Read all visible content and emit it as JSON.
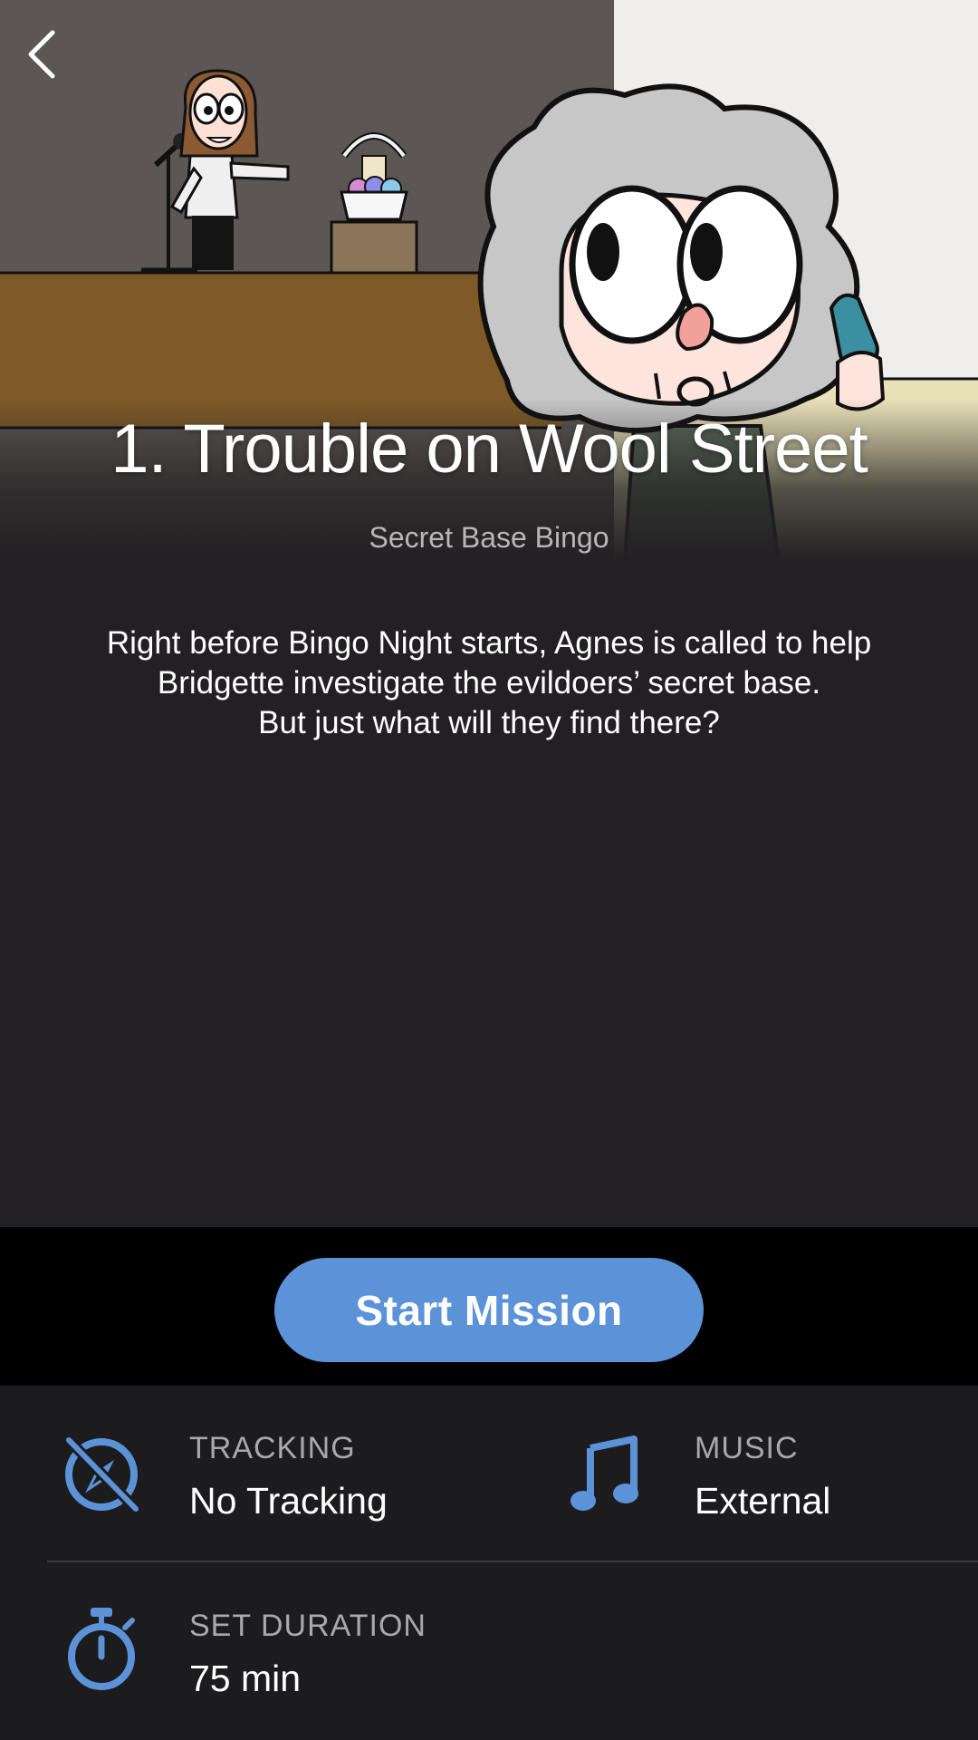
{
  "header": {
    "back_icon": "chevron-left-icon",
    "hero_image": "cartoon-illustration-grandma-on-phone-stage-with-microphone-and-yarn-basket"
  },
  "mission": {
    "title": "1. Trouble on Wool Street",
    "subtitle": "Secret Base Bingo",
    "description": [
      "Right before Bingo Night starts, Agnes is called to help",
      "Bridgette investigate the evildoers’ secret base.",
      "But just what will they find there?"
    ]
  },
  "actions": {
    "start_label": "Start Mission"
  },
  "settings": {
    "tracking": {
      "icon": "no-tracking-compass-icon",
      "label": "TRACKING",
      "value": "No Tracking"
    },
    "music": {
      "icon": "music-note-icon",
      "label": "MUSIC",
      "value": "External"
    },
    "duration": {
      "icon": "stopwatch-icon",
      "label": "SET DURATION",
      "value": "75 min"
    }
  },
  "colors": {
    "background": "#222022",
    "accent": "#5c93d8",
    "settings_bg": "#1c1c1e",
    "cta_bar_bg": "#000000"
  }
}
